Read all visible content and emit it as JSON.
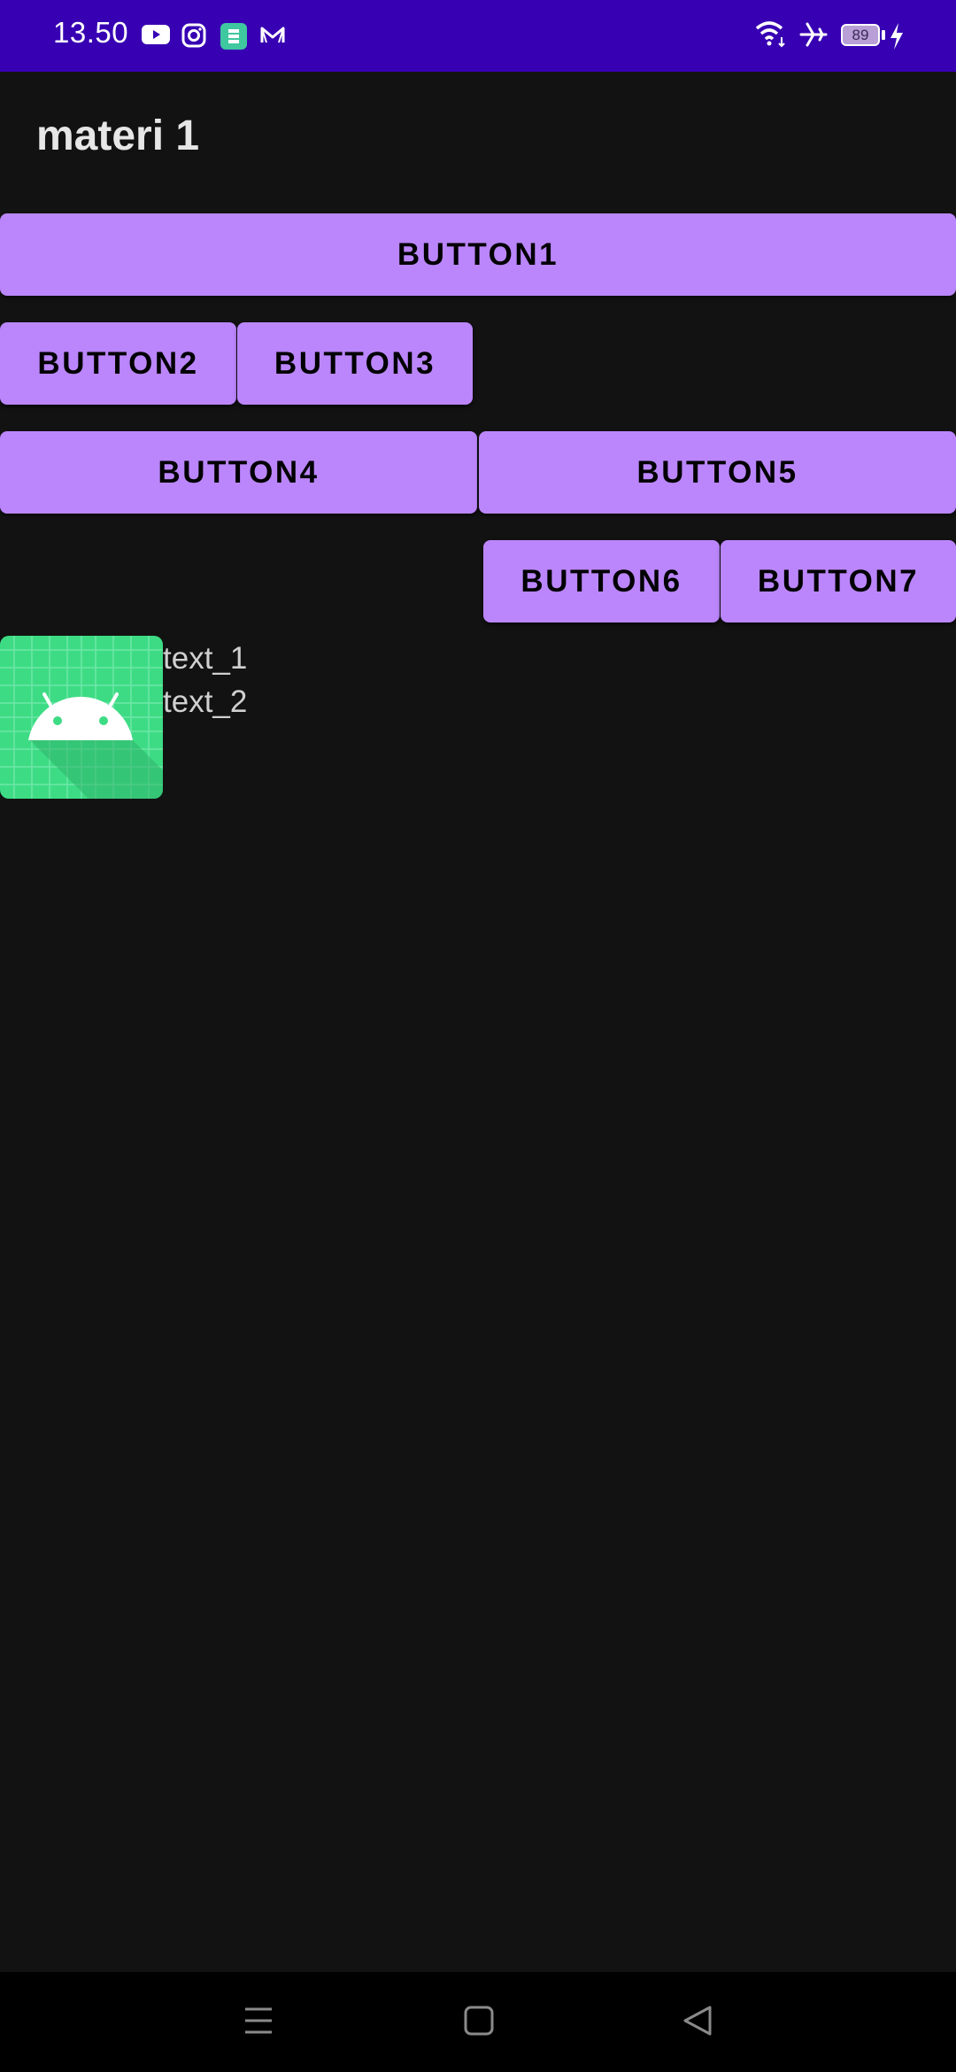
{
  "status_bar": {
    "time": "13.50",
    "battery_level": "89",
    "left_icons": [
      "youtube-icon",
      "instagram-icon",
      "app-icon",
      "mail-icon"
    ],
    "right_icons": [
      "wifi-icon",
      "airplane-icon",
      "battery-icon",
      "charging-icon"
    ],
    "background_color": "#3700B3"
  },
  "app_bar": {
    "title": "materi 1"
  },
  "buttons": {
    "button1": "BUTTON1",
    "button2": "BUTTON2",
    "button3": "BUTTON3",
    "button4": "BUTTON4",
    "button5": "BUTTON5",
    "button6": "BUTTON6",
    "button7": "BUTTON7",
    "color": "#BB86FC"
  },
  "content": {
    "image_icon": "android-launcher-icon",
    "text_1": "text_1",
    "text_2": "text_2"
  },
  "nav_bar": {
    "items": [
      "menu-icon",
      "home-icon",
      "back-icon"
    ]
  }
}
